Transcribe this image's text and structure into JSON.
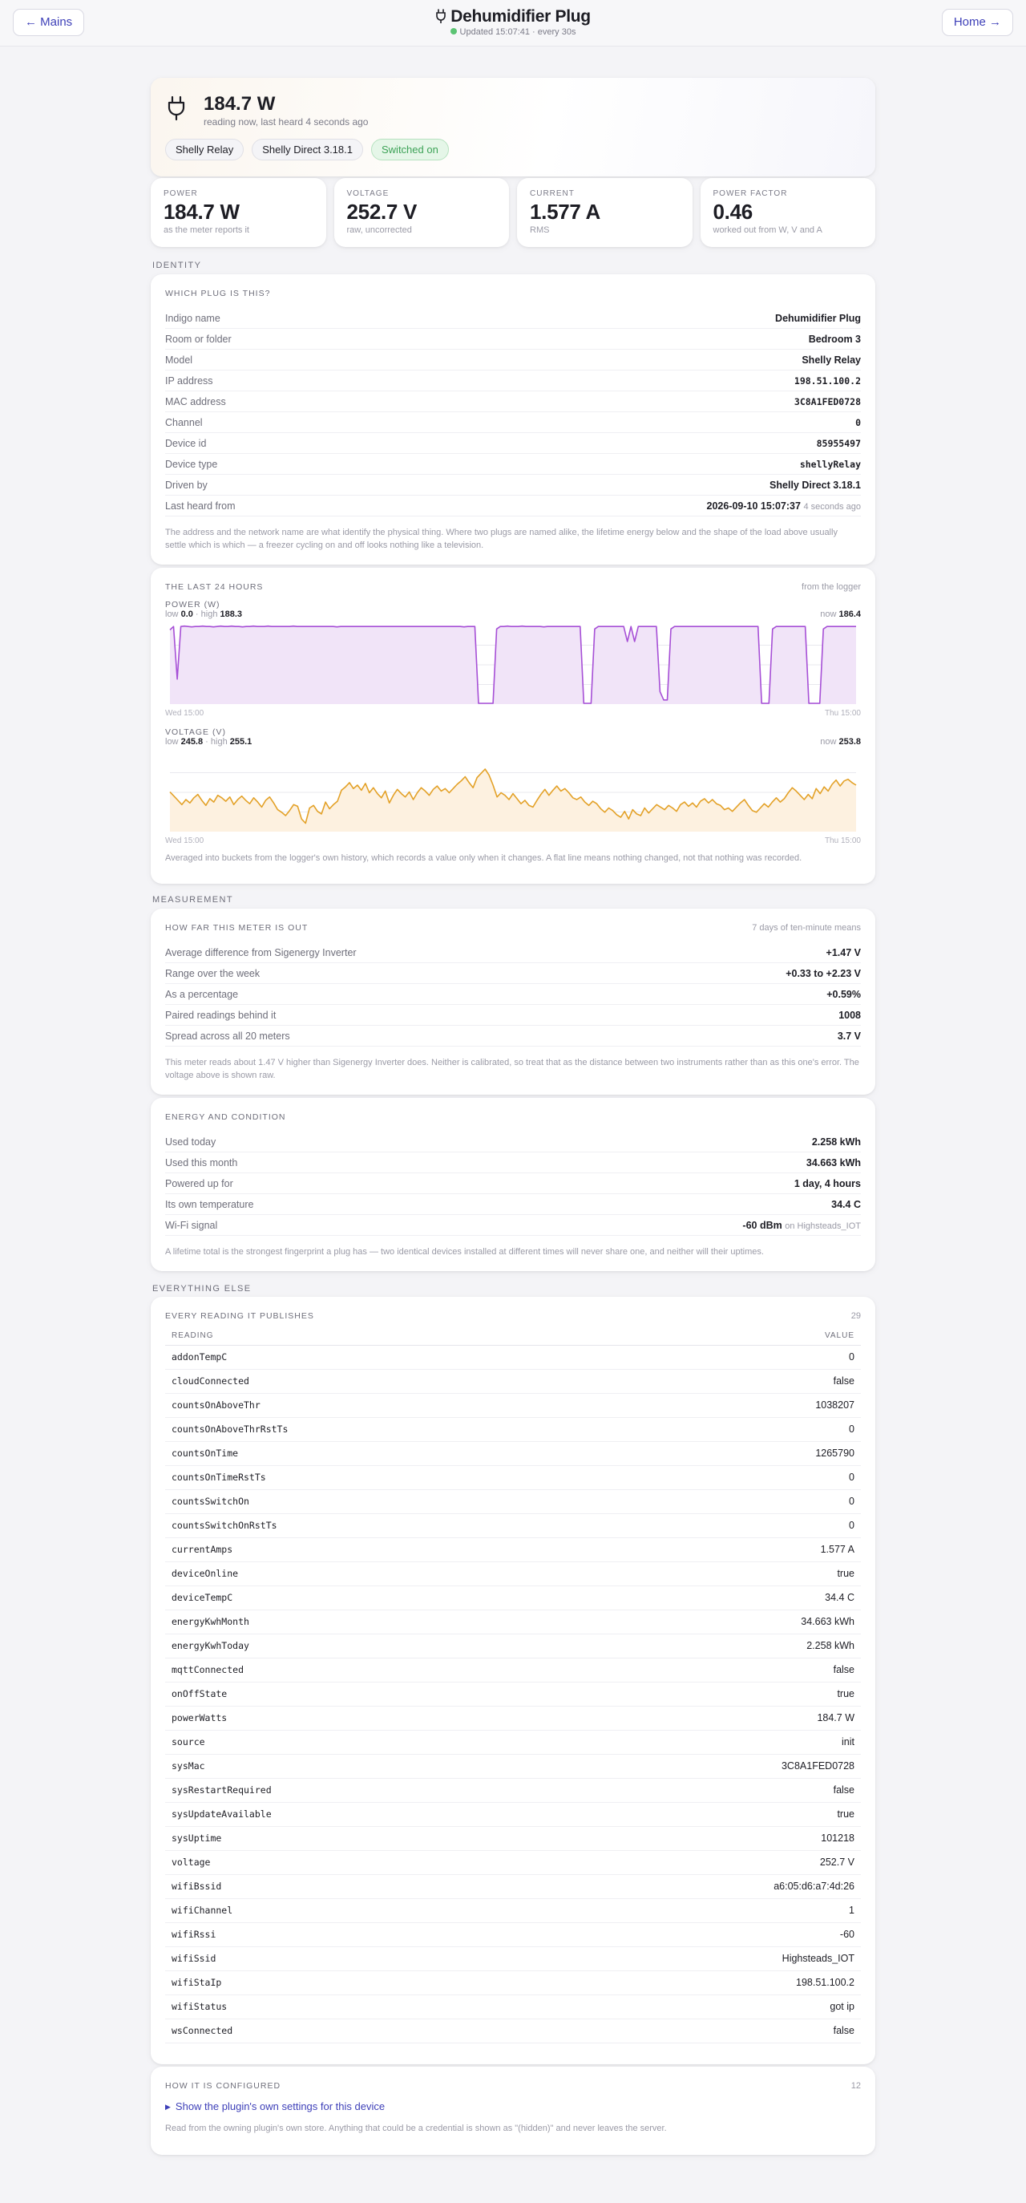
{
  "nav": {
    "back_label": "← Mains",
    "home_label": "Home →"
  },
  "header": {
    "title": "Dehumidifier Plug",
    "updated": "Updated 15:07:41 · every 30s"
  },
  "hero": {
    "reading": "184.7 W",
    "subtitle": "reading now, last heard 4 seconds ago",
    "chips": [
      "Shelly Relay",
      "Shelly Direct 3.18.1",
      "Switched on"
    ]
  },
  "tiles": [
    {
      "label": "POWER",
      "value": "184.7 W",
      "note": "as the meter reports it"
    },
    {
      "label": "VOLTAGE",
      "value": "252.7 V",
      "note": "raw, uncorrected"
    },
    {
      "label": "CURRENT",
      "value": "1.577 A",
      "note": "RMS"
    },
    {
      "label": "POWER FACTOR",
      "value": "0.46",
      "note": "worked out from W, V and A"
    }
  ],
  "sections": {
    "identity": "IDENTITY",
    "measurement": "MEASUREMENT",
    "everything": "EVERYTHING ELSE"
  },
  "identity": {
    "heading": "WHICH PLUG IS THIS?",
    "rows": [
      {
        "k": "Indigo name",
        "v": "Dehumidifier Plug"
      },
      {
        "k": "Room or folder",
        "v": "Bedroom 3"
      },
      {
        "k": "Model",
        "v": "Shelly Relay"
      },
      {
        "k": "IP address",
        "v": "198.51.100.2"
      },
      {
        "k": "MAC address",
        "v": "3C8A1FED0728"
      },
      {
        "k": "Channel",
        "v": "0"
      },
      {
        "k": "Device id",
        "v": "85955497"
      },
      {
        "k": "Device type",
        "v": "shellyRelay"
      },
      {
        "k": "Driven by",
        "v": "Shelly Direct 3.18.1"
      },
      {
        "k": "Last heard from",
        "v": "2026-09-10 15:07:37",
        "extra": "4 seconds ago"
      }
    ],
    "footnote": "The address and the network name are what identify the physical thing. Where two plugs are named alike, the lifetime energy below and the shape of the load above usually settle which is which — a freezer cycling on and off looks nothing like a television."
  },
  "history": {
    "heading": "THE LAST 24 HOURS",
    "source": "from the logger",
    "power": {
      "label": "POWER (W)",
      "low_label": "low",
      "low": "0.0",
      "high_label": "high",
      "high": "188.3",
      "now_label": "now",
      "now": "186.4",
      "x_start": "Wed 15:00",
      "x_end": "Thu 15:00"
    },
    "voltage": {
      "label": "VOLTAGE (V)",
      "low_label": "low",
      "low": "245.8",
      "high_label": "high",
      "high": "255.1",
      "now_label": "now",
      "now": "253.8",
      "x_start": "Wed 15:00",
      "x_end": "Thu 15:00"
    },
    "footnote": "Averaged into buckets from the logger's own history, which records a value only when it changes. A flat line means nothing changed, not that nothing was recorded."
  },
  "chart_data": [
    {
      "type": "area",
      "title": "POWER (W)",
      "ylim": [
        0,
        188.3
      ],
      "color": "#a64fd6",
      "fill": "#f1e4f8",
      "series": [
        {
          "values": [
            178,
            186,
            60,
            186,
            187,
            186,
            185,
            186,
            186,
            187,
            186,
            186,
            185,
            186,
            187,
            186,
            186,
            187,
            186,
            186,
            185,
            186,
            186,
            187,
            186,
            186,
            186,
            187,
            186,
            186,
            186,
            186,
            186,
            186,
            187,
            186,
            186,
            186,
            186,
            186,
            186,
            186,
            186,
            186,
            186,
            186,
            185,
            186,
            186,
            186,
            186,
            186,
            186,
            186,
            186,
            186,
            186,
            186,
            186,
            186,
            186,
            186,
            186,
            186,
            186,
            186,
            186,
            186,
            186,
            186,
            186,
            186,
            186,
            186,
            186,
            186,
            186,
            186,
            186,
            186,
            186,
            185,
            186,
            186,
            186,
            2,
            2,
            2,
            2,
            2,
            180,
            186,
            186,
            187,
            186,
            186,
            186,
            187,
            186,
            186,
            186,
            186,
            186,
            185,
            186,
            186,
            186,
            186,
            186,
            186,
            186,
            186,
            186,
            186,
            2,
            2,
            2,
            180,
            186,
            186,
            186,
            186,
            186,
            186,
            186,
            186,
            150,
            186,
            150,
            186,
            186,
            186,
            186,
            186,
            186,
            30,
            10,
            10,
            180,
            186,
            186,
            186,
            186,
            186,
            186,
            186,
            186,
            186,
            186,
            186,
            186,
            186,
            186,
            186,
            186,
            186,
            186,
            186,
            186,
            186,
            186,
            186,
            186,
            2,
            2,
            2,
            180,
            186,
            186,
            186,
            186,
            186,
            186,
            186,
            186,
            186,
            2,
            2,
            2,
            2,
            180,
            186,
            186,
            186,
            186,
            186,
            186,
            186,
            186,
            186
          ]
        }
      ]
    },
    {
      "type": "area",
      "title": "VOLTAGE (V)",
      "ylim": [
        245.8,
        255.1
      ],
      "color": "#e3a127",
      "fill": "#fdf1e0",
      "series": [
        {
          "values": [
            250.5,
            250,
            249.5,
            249,
            249.6,
            249.2,
            249.8,
            250.2,
            249.5,
            248.9,
            249.7,
            249.3,
            250.1,
            249.8,
            249.4,
            249.9,
            249,
            249.6,
            250,
            249.5,
            249.1,
            249.8,
            249.3,
            248.7,
            249.5,
            249.9,
            249.2,
            248.4,
            248.1,
            247.7,
            248.3,
            249,
            248.8,
            247.3,
            246.8,
            248.6,
            248.9,
            248.2,
            247.9,
            249.3,
            248.5,
            249,
            249.4,
            250.7,
            251.1,
            251.6,
            250.9,
            251.3,
            250.7,
            251.5,
            250.4,
            251,
            250.3,
            249.8,
            250.6,
            249.2,
            250.1,
            250.8,
            250.3,
            249.9,
            250.5,
            249.6,
            250.4,
            251,
            250.6,
            250.1,
            250.8,
            251.2,
            250.6,
            250.9,
            250.4,
            250.9,
            251.4,
            251.8,
            252.3,
            251.6,
            251,
            252.2,
            252.7,
            253.2,
            252.5,
            251.3,
            249.9,
            250.4,
            250.1,
            249.6,
            250.3,
            249.7,
            249.1,
            249.5,
            248.9,
            248.7,
            249.5,
            250.2,
            250.8,
            250.1,
            250.7,
            251.2,
            250.6,
            250.9,
            250.4,
            249.8,
            249.6,
            249.9,
            249.3,
            248.9,
            249.4,
            249.1,
            248.5,
            248.1,
            248.6,
            248.3,
            247.8,
            247.5,
            248.2,
            247.3,
            248.4,
            247.9,
            247.7,
            248.6,
            248,
            248.5,
            249,
            248.7,
            248.4,
            248.9,
            248.6,
            248.2,
            249,
            249.3,
            248.8,
            249.2,
            248.7,
            249.4,
            249.7,
            249.2,
            249.6,
            249.1,
            248.9,
            248.4,
            248.6,
            248.2,
            248.7,
            249.2,
            249.6,
            248.9,
            248.3,
            248.1,
            248.6,
            249.1,
            248.7,
            249.3,
            249.8,
            249.3,
            249.7,
            250.4,
            251,
            250.6,
            250.1,
            249.6,
            250.2,
            249.7,
            250.9,
            250.3,
            251.1,
            250.6,
            251.4,
            251.9,
            251.2,
            251.8,
            252,
            251.6,
            251.3
          ]
        }
      ]
    }
  ],
  "measurement": {
    "heading": "HOW FAR THIS METER IS OUT",
    "meta": "7 days of ten-minute means",
    "rows": [
      {
        "k": "Average difference from Sigenergy Inverter",
        "v": "+1.47 V"
      },
      {
        "k": "Range over the week",
        "v": "+0.33 to +2.23 V"
      },
      {
        "k": "As a percentage",
        "v": "+0.59%"
      },
      {
        "k": "Paired readings behind it",
        "v": "1008"
      },
      {
        "k": "Spread across all 20 meters",
        "v": "3.7 V"
      }
    ],
    "footnote": "This meter reads about 1.47 V higher than Sigenergy Inverter does. Neither is calibrated, so treat that as the distance between two instruments rather than as this one's error. The voltage above is shown raw."
  },
  "energy": {
    "heading": "ENERGY AND CONDITION",
    "rows": [
      {
        "k": "Used today",
        "v": "2.258 kWh"
      },
      {
        "k": "Used this month",
        "v": "34.663 kWh"
      },
      {
        "k": "Powered up for",
        "v": "1 day, 4 hours"
      },
      {
        "k": "Its own temperature",
        "v": "34.4 C"
      },
      {
        "k": "Wi-Fi signal",
        "v": "-60 dBm",
        "extra": "on Highsteads_IOT"
      }
    ],
    "footnote": "A lifetime total is the strongest fingerprint a plug has — two identical devices installed at different times will never share one, and neither will their uptimes."
  },
  "readings": {
    "heading": "EVERY READING IT PUBLISHES",
    "count": "29",
    "col_reading": "READING",
    "col_value": "VALUE",
    "rows": [
      {
        "k": "addonTempC",
        "v": "0"
      },
      {
        "k": "cloudConnected",
        "v": "false"
      },
      {
        "k": "countsOnAboveThr",
        "v": "1038207"
      },
      {
        "k": "countsOnAboveThrRstTs",
        "v": "0"
      },
      {
        "k": "countsOnTime",
        "v": "1265790"
      },
      {
        "k": "countsOnTimeRstTs",
        "v": "0"
      },
      {
        "k": "countsSwitchOn",
        "v": "0"
      },
      {
        "k": "countsSwitchOnRstTs",
        "v": "0"
      },
      {
        "k": "currentAmps",
        "v": "1.577 A"
      },
      {
        "k": "deviceOnline",
        "v": "true"
      },
      {
        "k": "deviceTempC",
        "v": "34.4 C"
      },
      {
        "k": "energyKwhMonth",
        "v": "34.663 kWh"
      },
      {
        "k": "energyKwhToday",
        "v": "2.258 kWh"
      },
      {
        "k": "mqttConnected",
        "v": "false"
      },
      {
        "k": "onOffState",
        "v": "true"
      },
      {
        "k": "powerWatts",
        "v": "184.7 W"
      },
      {
        "k": "source",
        "v": "init"
      },
      {
        "k": "sysMac",
        "v": "3C8A1FED0728"
      },
      {
        "k": "sysRestartRequired",
        "v": "false"
      },
      {
        "k": "sysUpdateAvailable",
        "v": "true"
      },
      {
        "k": "sysUptime",
        "v": "101218"
      },
      {
        "k": "voltage",
        "v": "252.7 V"
      },
      {
        "k": "wifiBssid",
        "v": "a6:05:d6:a7:4d:26"
      },
      {
        "k": "wifiChannel",
        "v": "1"
      },
      {
        "k": "wifiRssi",
        "v": "-60"
      },
      {
        "k": "wifiSsid",
        "v": "Highsteads_IOT"
      },
      {
        "k": "wifiStaIp",
        "v": "198.51.100.2"
      },
      {
        "k": "wifiStatus",
        "v": "got ip"
      },
      {
        "k": "wsConnected",
        "v": "false"
      }
    ]
  },
  "config": {
    "heading": "HOW IT IS CONFIGURED",
    "count": "12",
    "toggle": "Show the plugin's own settings for this device",
    "footnote": "Read from the owning plugin's own store. Anything that could be a credential is shown as \"(hidden)\" and never leaves the server."
  },
  "colors": {
    "accent": "#3d3fb8",
    "on_green": "#3da257",
    "power_line": "#a64fd6",
    "voltage_line": "#e3a127"
  }
}
